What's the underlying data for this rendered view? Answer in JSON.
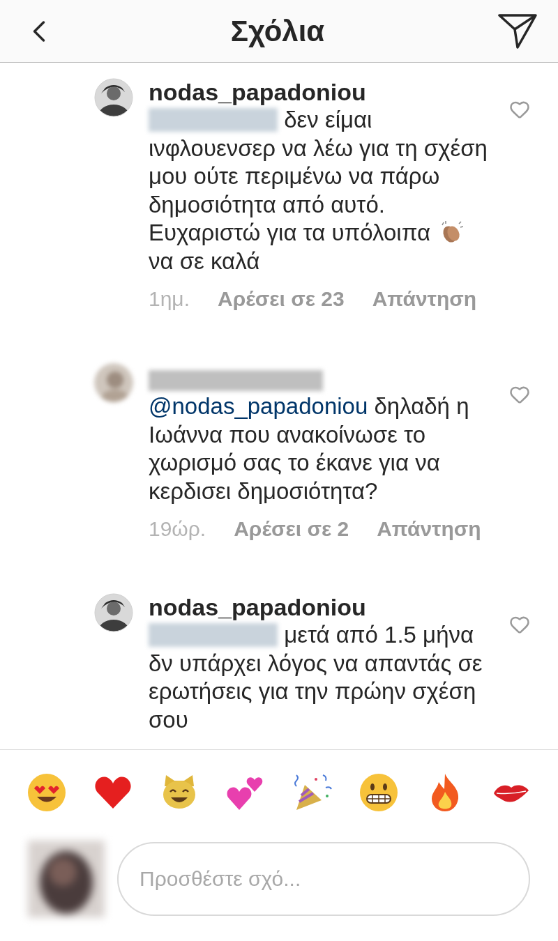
{
  "header": {
    "title": "Σχόλια"
  },
  "comments": [
    {
      "avatar": {
        "kind": "photo"
      },
      "username": "nodas_papadoniou",
      "body": [
        {
          "kind": "blurred"
        },
        {
          "kind": "text",
          "text": " δεν είμαι ινφλουενσερ να λέω για τη σχέση μου ούτε περιμένω να πάρω δημοσιότητα από αυτό. Ευχαριστώ για τα υπόλοιπα "
        },
        {
          "kind": "clap"
        },
        {
          "kind": "text",
          "text": " να σε καλά"
        }
      ],
      "time": "1ημ.",
      "likes": "Αρέσει σε 23",
      "reply": "Απάντηση",
      "liked": false
    },
    {
      "avatar": {
        "kind": "blurred"
      },
      "body": [
        {
          "kind": "mention",
          "text": "@nodas_papadoniou"
        },
        {
          "kind": "text",
          "text": " δηλαδή η Ιωάννα που ανακοίνωσε το χωρισμό σας το έκανε για να κερδισει δημοσιότητα?"
        }
      ],
      "time": "19ώρ.",
      "likes": "Αρέσει σε 2",
      "reply": "Απάντηση",
      "liked": false
    },
    {
      "avatar": {
        "kind": "photo"
      },
      "username": "nodas_papadoniou",
      "body": [
        {
          "kind": "blurred"
        },
        {
          "kind": "text",
          "text": " μετά από 1.5 μήνα δν υπάρχει λόγος να απαντάς σε ερωτήσεις για την πρώην σχέση σου"
        }
      ],
      "liked": false
    }
  ],
  "emoji_bar": [
    {
      "kind": "heart-eyes"
    },
    {
      "kind": "heart"
    },
    {
      "kind": "cat"
    },
    {
      "kind": "two-hearts"
    },
    {
      "kind": "party"
    },
    {
      "kind": "grimace"
    },
    {
      "kind": "fire"
    },
    {
      "kind": "kiss"
    }
  ],
  "composer": {
    "placeholder": "Προσθέστε σχό..."
  }
}
